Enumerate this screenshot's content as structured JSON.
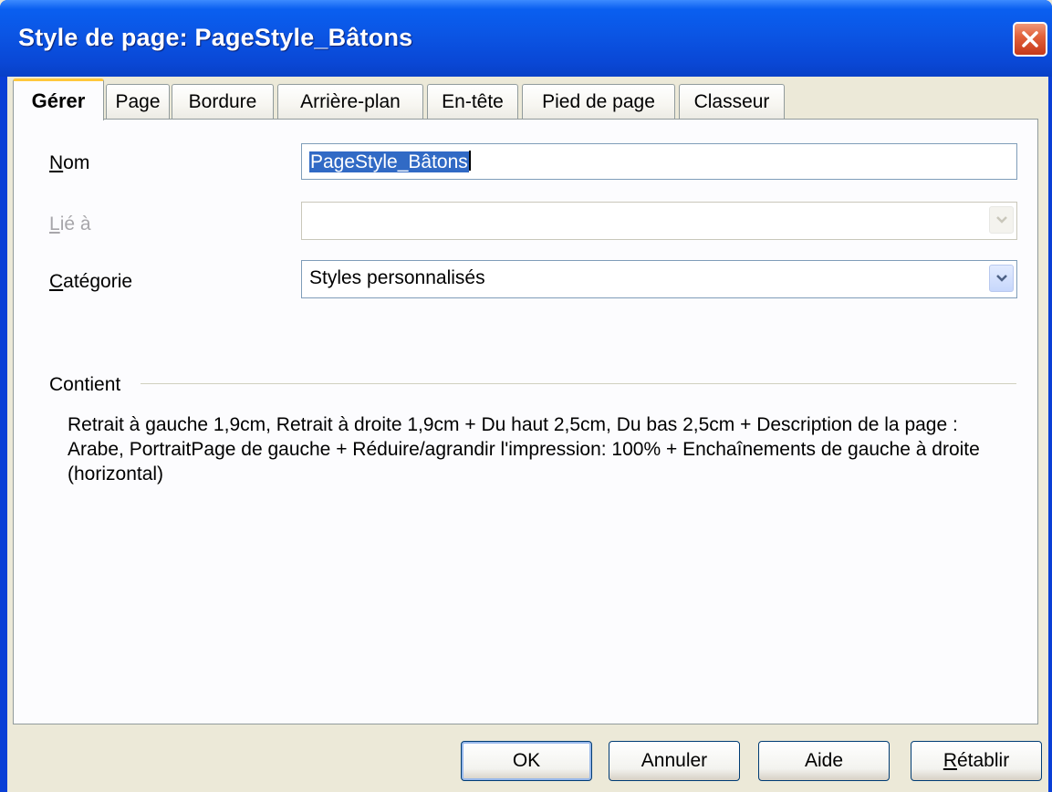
{
  "window": {
    "title": "Style de page: PageStyle_Bâtons"
  },
  "tabs": [
    {
      "label": "Gérer",
      "active": true
    },
    {
      "label": "Page",
      "active": false
    },
    {
      "label": "Bordure",
      "active": false
    },
    {
      "label": "Arrière-plan",
      "active": false
    },
    {
      "label": "En-tête",
      "active": false
    },
    {
      "label": "Pied de page",
      "active": false
    },
    {
      "label": "Classeur",
      "active": false
    }
  ],
  "form": {
    "name_label_first": "N",
    "name_label_rest": "om",
    "name_value": "PageStyle_Bâtons",
    "linked_label_first": "L",
    "linked_label_rest": "ié à",
    "linked_value": "",
    "category_label_first": "C",
    "category_label_rest": "atégorie",
    "category_value": "Styles personnalisés"
  },
  "contains": {
    "heading": "Contient",
    "description": "Retrait à gauche 1,9cm, Retrait à droite 1,9cm + Du haut 2,5cm, Du bas 2,5cm + Description de la page : Arabe, PortraitPage de gauche + Réduire/agrandir l'impression: 100% + Enchaînements de gauche à droite (horizontal)"
  },
  "buttons": {
    "ok": "OK",
    "cancel": "Annuler",
    "help": "Aide",
    "reset_first": "R",
    "reset_rest": "établir"
  },
  "colors": {
    "titlebar": "#0a5ff0",
    "selection": "#316ac5",
    "active_tab_accent": "#ffc83c"
  }
}
